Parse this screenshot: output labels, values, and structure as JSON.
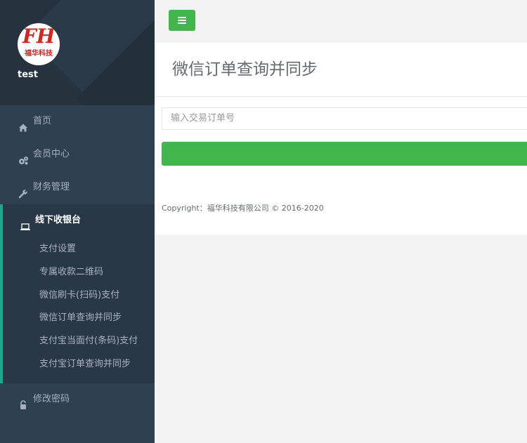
{
  "colors": {
    "sidebar_bg": "#2f4050",
    "accent_green": "#42b54b",
    "active_bar": "#19aa8d",
    "logo_red": "#d8231d"
  },
  "profile": {
    "logo_mark": "FH",
    "logo_brand": "福华科技",
    "username": "test"
  },
  "nav": {
    "home": {
      "label": "首页",
      "icon": "home-icon"
    },
    "members": {
      "label": "会员中心",
      "icon": "gears-icon"
    },
    "finance": {
      "label": "财务管理",
      "icon": "wrench-icon"
    },
    "offline": {
      "label": "线下收银台",
      "icon": "laptop-icon",
      "items": [
        "支付设置",
        "专属收款二维码",
        "微信刷卡(扫码)支付",
        "微信订单查询并同步",
        "支付宝当面付(条码)支付",
        "支付宝订单查询并同步"
      ]
    },
    "password": {
      "label": "修改密码",
      "icon": "lock-icon"
    }
  },
  "topbar": {
    "menu_icon": "hamburger-icon"
  },
  "page": {
    "title": "微信订单查询并同步",
    "order_input_placeholder": "输入交易订单号",
    "order_input_value": "",
    "submit_label": "",
    "footer": "Copyright：福华科技有限公司 © 2016-2020"
  }
}
